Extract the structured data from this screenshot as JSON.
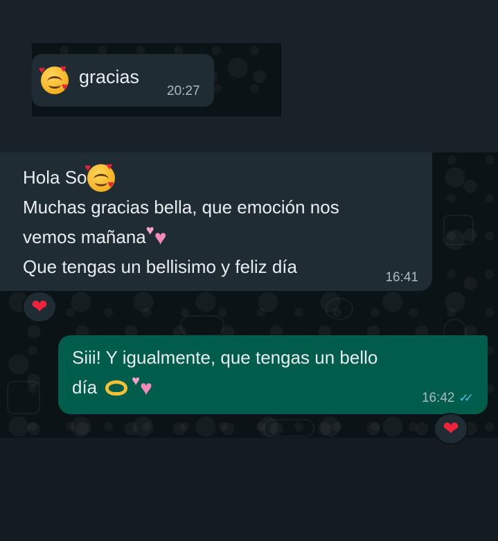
{
  "messages": [
    {
      "direction": "incoming",
      "lines": [
        "gracias"
      ],
      "leading_emoji": "smiling-face-with-hearts",
      "time": "20:27"
    },
    {
      "direction": "incoming",
      "lines": [
        "Hola So",
        "Muchas gracias bella, que emoción nos",
        "vemos mañana",
        "Que tengas un bellisimo y feliz día"
      ],
      "emojis": [
        "smiling-face-with-hearts",
        "revolving-hearts"
      ],
      "time": "16:41",
      "reaction": "❤"
    },
    {
      "direction": "outgoing",
      "lines": [
        "Siii! Y igualmente, que tengas un bello",
        "día"
      ],
      "emojis": [
        "heart-hands",
        "revolving-hearts"
      ],
      "time": "16:42",
      "status_icon": "double-check-read",
      "reaction": "❤"
    }
  ],
  "colors": {
    "incoming_bubble": "#1f2c34",
    "outgoing_bubble": "#005c4b",
    "read_ticks": "#53bdeb",
    "reaction_heart": "#f0233a"
  }
}
